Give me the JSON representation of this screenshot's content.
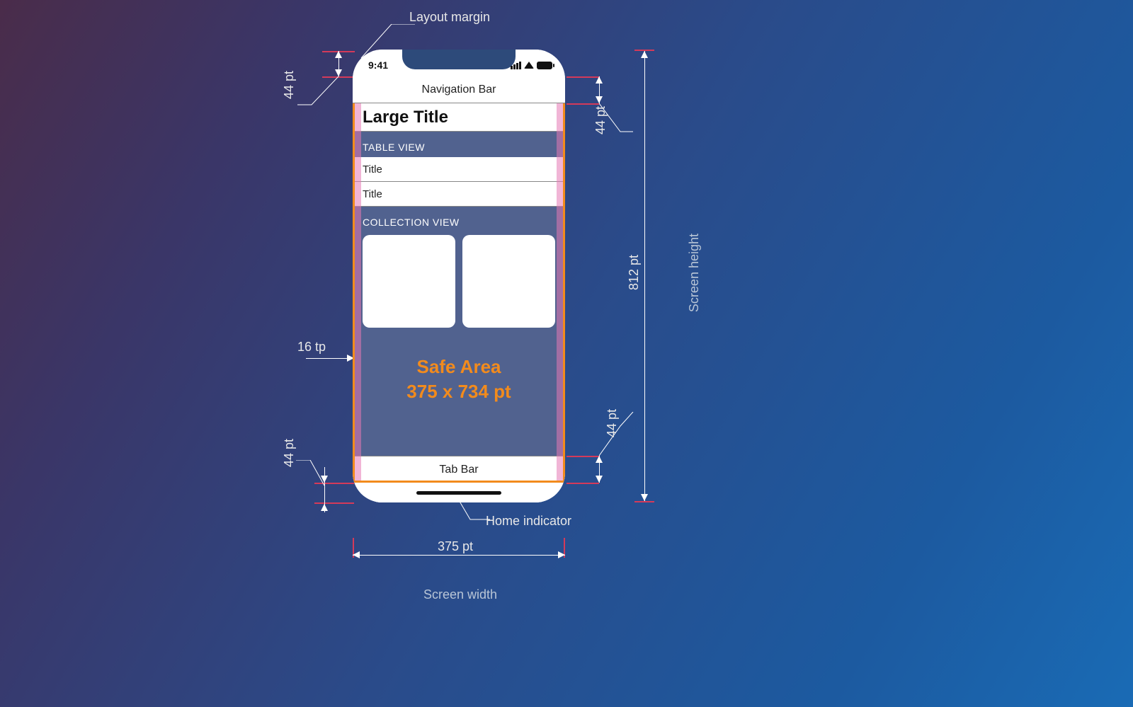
{
  "annotations": {
    "layout_margin": "Layout margin",
    "home_indicator": "Home indicator",
    "screen_width": "Screen width",
    "screen_height": "Screen height",
    "layout_margin_value": "16 tp",
    "width_value": "375 pt",
    "height_value": "812 pt",
    "status_bar_height": "44 pt",
    "nav_bar_height": "44 pt",
    "tab_bar_height": "44 pt",
    "home_indicator_height": "44 pt"
  },
  "phone": {
    "statusbar": {
      "time": "9:41"
    },
    "navbar_label": "Navigation Bar",
    "large_title": "Large Title",
    "table_view_header": "TABLE VIEW",
    "table_rows": [
      "Title",
      "Title"
    ],
    "collection_view_header": "COLLECTION VIEW",
    "safe_area_line1": "Safe Area",
    "safe_area_line2": "375 x 734 pt",
    "tabbar_label": "Tab Bar"
  }
}
